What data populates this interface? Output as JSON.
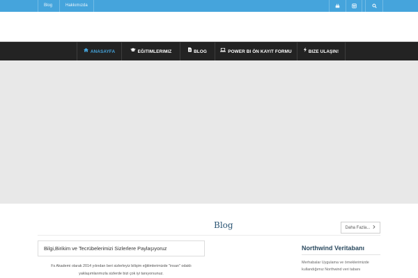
{
  "topbar": {
    "links": [
      "Blog",
      "Hakkımızda"
    ],
    "icons": [
      "youtube-icon",
      "instagram-icon",
      "search-icon"
    ],
    "color": "#45a4dc"
  },
  "nav": {
    "items": [
      {
        "label": "ANASAYFA",
        "icon": "home-icon",
        "active": true
      },
      {
        "label": "EĞITIMLERIMIZ",
        "icon": "graduation-cap-icon",
        "active": false
      },
      {
        "label": "BLOG",
        "icon": "document-icon",
        "active": false
      },
      {
        "label": "POWER BI ÖN KAYIT FORMU",
        "icon": "laptop-icon",
        "active": false
      },
      {
        "label": "BIZE ULAŞIN!",
        "icon": "bolt-icon",
        "active": false
      }
    ],
    "background": "#232323",
    "active_color": "#45a4dc"
  },
  "blog": {
    "title": "Blog",
    "more_label": "Daha Fazla...",
    "card_title": "Bilgi,Birikim ve Tecrübelerimizi Sizlerlere Paylaşıyoruz",
    "description": "Fs Akademi olarak 2014 yılından beri sizlerleyiz bilişim eğitimlerimizde  \"insan\" odaklı yaklaşımlarımızla sizlerde bizi çok iyi tanıyorsunuz."
  },
  "sidebar": {
    "title": "Northwind Veritabanı",
    "text": "Merhabalar Uygulama ve örneklerimizde kullandığımız Northwind veri tabanı"
  }
}
